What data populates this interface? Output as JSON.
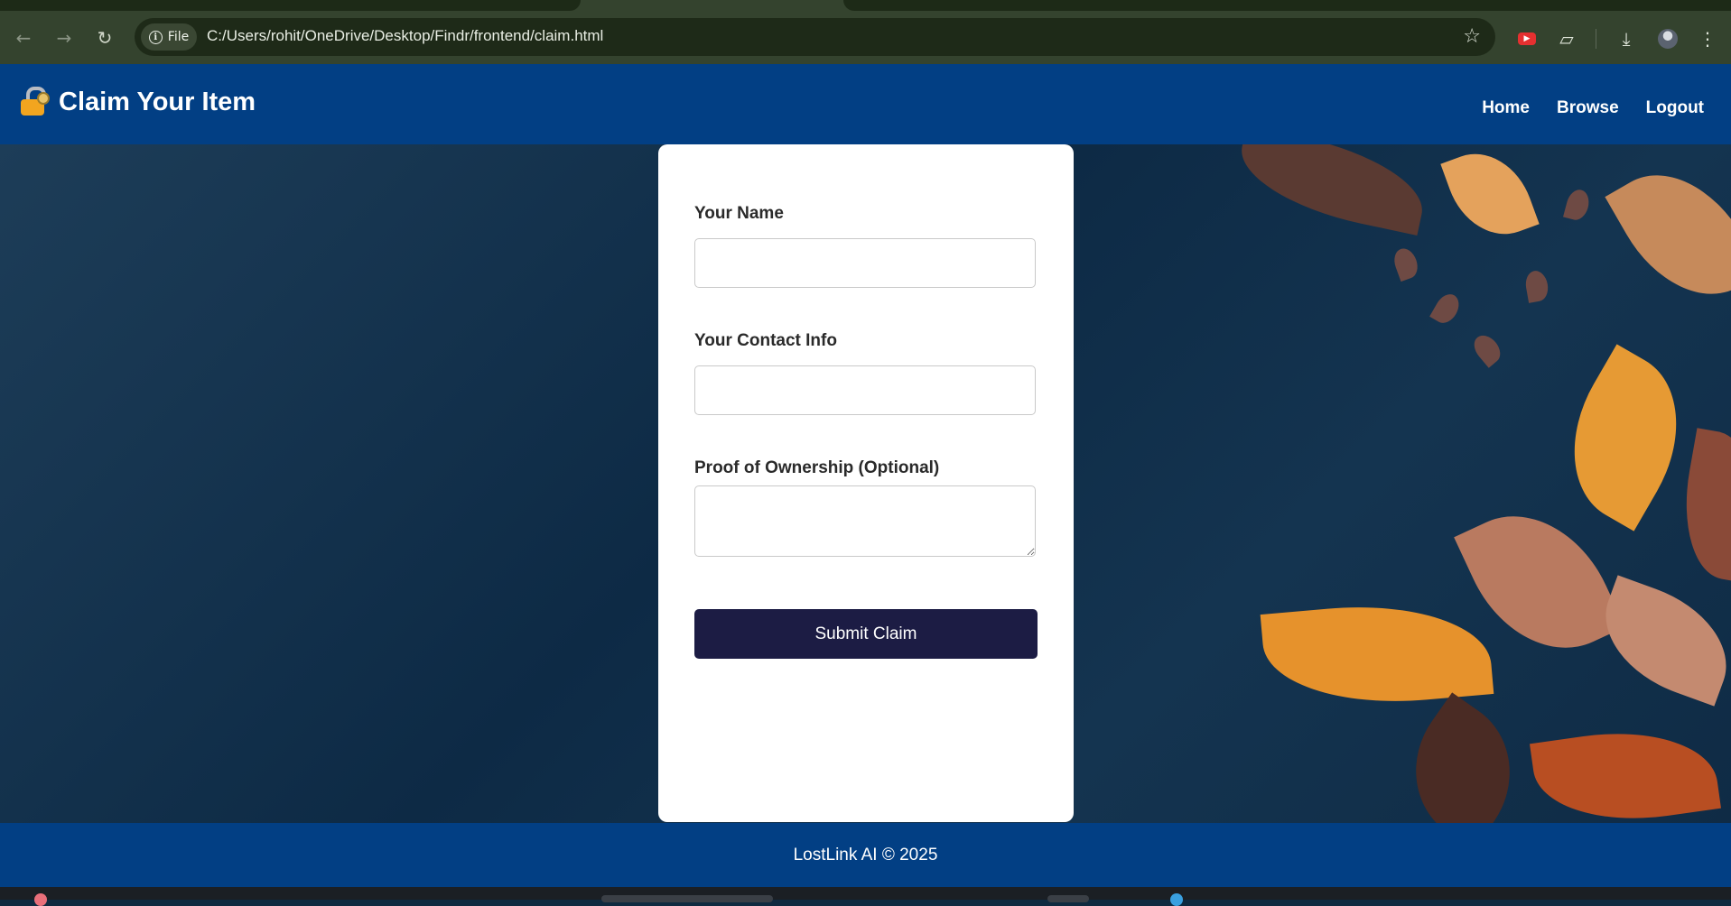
{
  "browser": {
    "file_chip_label": "File",
    "url": "C:/Users/rohit/OneDrive/Desktop/Findr/frontend/claim.html",
    "icons": {
      "back": "arrow-left-icon",
      "forward": "arrow-right-icon",
      "reload": "reload-icon",
      "info": "info-icon",
      "bookmark": "star-icon",
      "extension_youtube": "youtube-extension-icon",
      "extensions": "puzzle-icon",
      "downloads": "download-icon",
      "profile": "avatar",
      "menu": "kebab-menu-icon"
    }
  },
  "header": {
    "title": "Claim Your Item",
    "icon": "lock-with-key-icon",
    "nav": [
      "Home",
      "Browse",
      "Logout"
    ]
  },
  "form": {
    "name_label": "Your Name",
    "name_value": "",
    "contact_label": "Your Contact Info",
    "contact_value": "",
    "proof_label": "Proof of Ownership (Optional)",
    "proof_value": "",
    "submit_label": "Submit Claim"
  },
  "footer": {
    "text": "LostLink AI © 2025"
  },
  "colors": {
    "header_bg": "#023f84",
    "footer_bg": "#023f84",
    "button_bg": "#1c1c44",
    "card_bg": "#ffffff",
    "page_bg": "#0f2a40"
  }
}
